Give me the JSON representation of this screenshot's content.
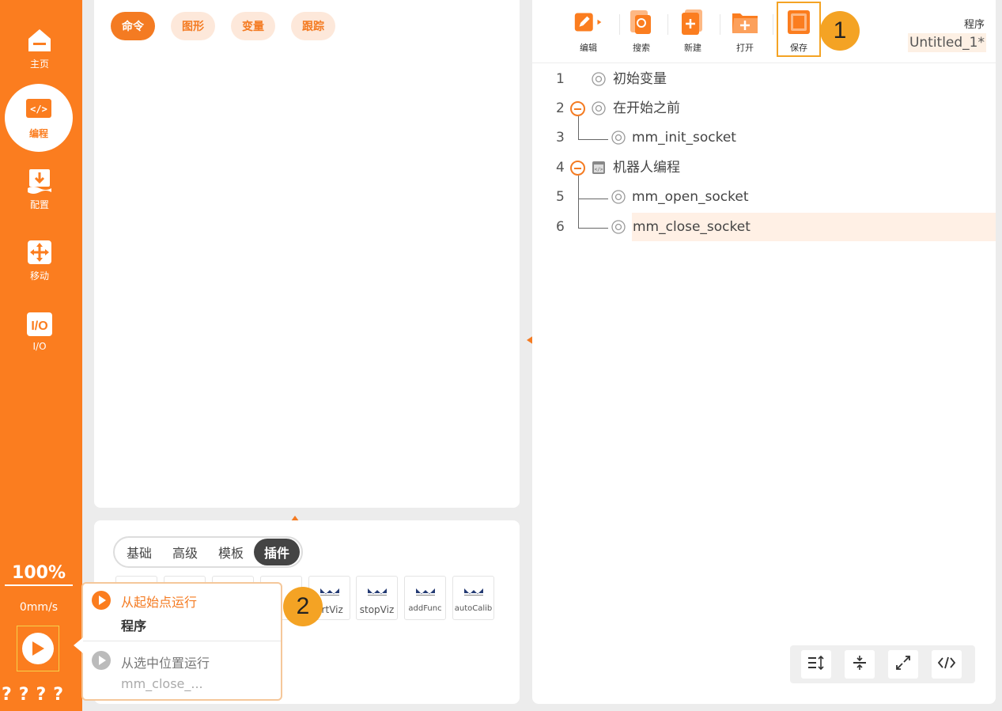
{
  "sidebar": {
    "items": [
      {
        "label": "主页",
        "icon": "home-icon"
      },
      {
        "label": "编程",
        "icon": "code-icon"
      },
      {
        "label": "配置",
        "icon": "download-config-icon"
      },
      {
        "label": "移动",
        "icon": "move-arrows-icon"
      },
      {
        "label": "I/O",
        "icon": "io-icon",
        "icon_text": "I/O"
      }
    ],
    "speed_percent": "100%",
    "speed_value": "0mm/s",
    "help_marks": "????"
  },
  "command_panel": {
    "tabs": [
      "命令",
      "图形",
      "变量",
      "跟踪"
    ]
  },
  "library": {
    "segments": [
      "基础",
      "高级",
      "模板",
      "插件"
    ],
    "plugins": [
      "artViz",
      "stopViz",
      "addFunc",
      "autoCalib"
    ]
  },
  "run_popup": {
    "option1_title": "从起始点运行",
    "option1_sub": "程序",
    "option2_title": "从选中位置运行",
    "option2_sub": "mm_close_..."
  },
  "callouts": {
    "one": "1",
    "two": "2"
  },
  "toolbar": {
    "edit": "编辑",
    "search": "搜索",
    "new": "新建",
    "open": "打开",
    "save": "保存",
    "program_label": "程序",
    "program_name": "Untitled_1*"
  },
  "program_tree": [
    {
      "num": "1",
      "text": "初始变量"
    },
    {
      "num": "2",
      "text": "在开始之前"
    },
    {
      "num": "3",
      "text": "mm_init_socket"
    },
    {
      "num": "4",
      "text": "机器人编程"
    },
    {
      "num": "5",
      "text": "mm_open_socket"
    },
    {
      "num": "6",
      "text": "mm_close_socket"
    }
  ],
  "colors": {
    "accent": "#fb7d1f",
    "callout": "#f4a324",
    "selected_row": "#fff0e5"
  }
}
